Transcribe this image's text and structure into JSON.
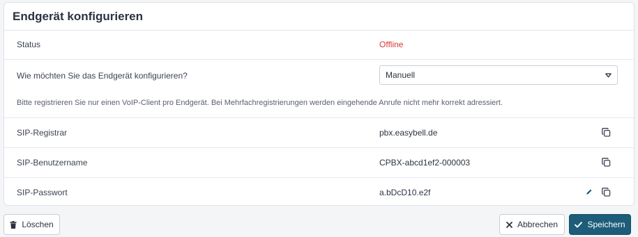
{
  "card": {
    "title": "Endgerät konfigurieren"
  },
  "status": {
    "label": "Status",
    "value": "Offline",
    "value_color": "#d33b3b"
  },
  "config": {
    "question": "Wie möchten Sie das Endgerät konfigurieren?",
    "selected_option": "Manuell",
    "hint": "Bitte registrieren Sie nur einen VoIP-Client pro Endgerät. Bei Mehrfachregistrierungen werden eingehende Anrufe nicht mehr korrekt adressiert."
  },
  "sip": {
    "registrar_label": "SIP-Registrar",
    "registrar_value": "pbx.easybell.de",
    "username_label": "SIP-Benutzername",
    "username_value": "CPBX-abcd1ef2-000003",
    "password_label": "SIP-Passwort",
    "password_value": "a.bDcD10.e2f"
  },
  "actions": {
    "delete_label": "Löschen",
    "cancel_label": "Abbrechen",
    "save_label": "Speichern"
  },
  "icons": {
    "delete": "trash-icon",
    "cancel": "close-icon",
    "save": "check-icon",
    "copy": "copy-icon",
    "edit": "pencil-icon",
    "select": "caret-down-icon"
  },
  "colors": {
    "primary": "#1d5d7a",
    "status_offline": "#d33b3b"
  }
}
